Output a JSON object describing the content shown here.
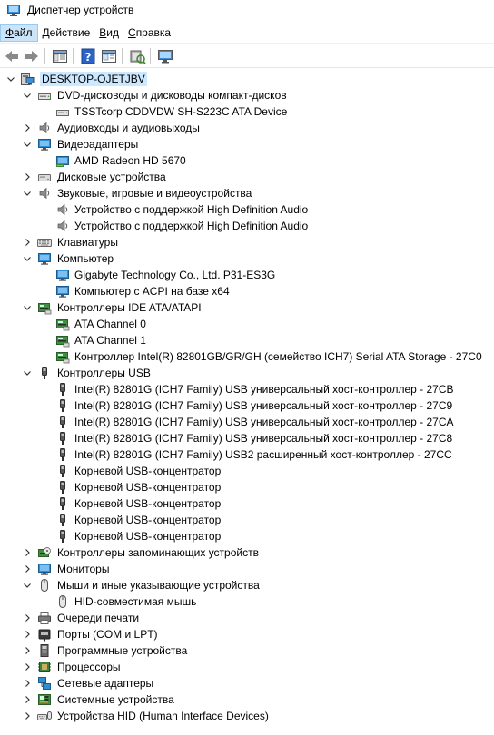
{
  "window": {
    "title": "Диспетчер устройств"
  },
  "menu": [
    {
      "label": "Файл",
      "active": true
    },
    {
      "label": "Действие",
      "active": false
    },
    {
      "label": "Вид",
      "active": false
    },
    {
      "label": "Справка",
      "active": false
    }
  ],
  "toolbar": [
    {
      "name": "back-button",
      "icon": "arrow-left-icon"
    },
    {
      "name": "forward-button",
      "icon": "arrow-right-icon"
    },
    {
      "name": "show-hide-console-tree-button",
      "icon": "console-tree-icon"
    },
    {
      "name": "help-button",
      "icon": "help-icon"
    },
    {
      "name": "properties-button",
      "icon": "properties-icon"
    },
    {
      "name": "scan-hardware-changes-button",
      "icon": "scan-hardware-icon"
    },
    {
      "name": "update-driver-button",
      "icon": "monitor-icon"
    }
  ],
  "tree": [
    {
      "level": 0,
      "expand": "open",
      "icon": "computer",
      "label": "DESKTOP-OJETJBV",
      "selected": true
    },
    {
      "level": 1,
      "expand": "open",
      "icon": "disc",
      "label": "DVD-дисководы и дисководы компакт-дисков"
    },
    {
      "level": 2,
      "expand": "none",
      "icon": "disc",
      "label": "TSSTcorp CDDVDW SH-S223C ATA Device"
    },
    {
      "level": 1,
      "expand": "closed",
      "icon": "speaker",
      "label": "Аудиовходы и аудиовыходы"
    },
    {
      "level": 1,
      "expand": "open",
      "icon": "monitor",
      "label": "Видеоадаптеры"
    },
    {
      "level": 2,
      "expand": "none",
      "icon": "gpu",
      "label": "AMD Radeon HD 5670"
    },
    {
      "level": 1,
      "expand": "closed",
      "icon": "disk",
      "label": "Дисковые устройства"
    },
    {
      "level": 1,
      "expand": "open",
      "icon": "speaker",
      "label": "Звуковые, игровые и видеоустройства"
    },
    {
      "level": 2,
      "expand": "none",
      "icon": "speaker",
      "label": "Устройство с поддержкой High Definition Audio"
    },
    {
      "level": 2,
      "expand": "none",
      "icon": "speaker",
      "label": "Устройство с поддержкой High Definition Audio"
    },
    {
      "level": 1,
      "expand": "closed",
      "icon": "keyboard",
      "label": "Клавиатуры"
    },
    {
      "level": 1,
      "expand": "open",
      "icon": "monitor",
      "label": "Компьютер"
    },
    {
      "level": 2,
      "expand": "none",
      "icon": "monitor",
      "label": "Gigabyte Technology Co., Ltd. P31-ES3G"
    },
    {
      "level": 2,
      "expand": "none",
      "icon": "monitor",
      "label": "Компьютер с ACPI на базе x64"
    },
    {
      "level": 1,
      "expand": "open",
      "icon": "controller",
      "label": "Контроллеры IDE ATA/ATAPI"
    },
    {
      "level": 2,
      "expand": "none",
      "icon": "controller",
      "label": "ATA Channel 0"
    },
    {
      "level": 2,
      "expand": "none",
      "icon": "controller",
      "label": "ATA Channel 1"
    },
    {
      "level": 2,
      "expand": "none",
      "icon": "controller",
      "label": "Контроллер Intel(R) 82801GB/GR/GH (семейство ICH7) Serial ATA Storage - 27C0"
    },
    {
      "level": 1,
      "expand": "open",
      "icon": "usb",
      "label": "Контроллеры USB"
    },
    {
      "level": 2,
      "expand": "none",
      "icon": "usb",
      "label": "Intel(R) 82801G (ICH7 Family) USB универсальный хост-контроллер  - 27CB"
    },
    {
      "level": 2,
      "expand": "none",
      "icon": "usb",
      "label": "Intel(R) 82801G (ICH7 Family) USB универсальный хост-контроллер - 27C9"
    },
    {
      "level": 2,
      "expand": "none",
      "icon": "usb",
      "label": "Intel(R) 82801G (ICH7 Family) USB универсальный хост-контроллер - 27CA"
    },
    {
      "level": 2,
      "expand": "none",
      "icon": "usb",
      "label": "Intel(R) 82801G (ICH7 Family) USB универсальный хост-контроллер - 27C8"
    },
    {
      "level": 2,
      "expand": "none",
      "icon": "usb",
      "label": "Intel(R) 82801G (ICH7 Family) USB2 расширенный хост-контроллер - 27CC"
    },
    {
      "level": 2,
      "expand": "none",
      "icon": "usb",
      "label": "Корневой USB-концентратор"
    },
    {
      "level": 2,
      "expand": "none",
      "icon": "usb",
      "label": "Корневой USB-концентратор"
    },
    {
      "level": 2,
      "expand": "none",
      "icon": "usb",
      "label": "Корневой USB-концентратор"
    },
    {
      "level": 2,
      "expand": "none",
      "icon": "usb",
      "label": "Корневой USB-концентратор"
    },
    {
      "level": 2,
      "expand": "none",
      "icon": "usb",
      "label": "Корневой USB-концентратор"
    },
    {
      "level": 1,
      "expand": "closed",
      "icon": "storage",
      "label": "Контроллеры запоминающих устройств"
    },
    {
      "level": 1,
      "expand": "closed",
      "icon": "monitor",
      "label": "Мониторы"
    },
    {
      "level": 1,
      "expand": "open",
      "icon": "mouse",
      "label": "Мыши и иные указывающие устройства"
    },
    {
      "level": 2,
      "expand": "none",
      "icon": "mouse",
      "label": "HID-совместимая мышь"
    },
    {
      "level": 1,
      "expand": "closed",
      "icon": "printer",
      "label": "Очереди печати"
    },
    {
      "level": 1,
      "expand": "closed",
      "icon": "port",
      "label": "Порты (COM и LPT)"
    },
    {
      "level": 1,
      "expand": "closed",
      "icon": "software",
      "label": "Программные устройства"
    },
    {
      "level": 1,
      "expand": "closed",
      "icon": "processor",
      "label": "Процессоры"
    },
    {
      "level": 1,
      "expand": "closed",
      "icon": "network",
      "label": "Сетевые адаптеры"
    },
    {
      "level": 1,
      "expand": "closed",
      "icon": "system",
      "label": "Системные устройства"
    },
    {
      "level": 1,
      "expand": "closed",
      "icon": "hid",
      "label": "Устройства HID (Human Interface Devices)"
    }
  ],
  "colors": {
    "selection": "#cce8ff",
    "menu_active": "#cce4f7",
    "monitor_blue": "#2d8fd5",
    "usb_grey": "#404040"
  }
}
